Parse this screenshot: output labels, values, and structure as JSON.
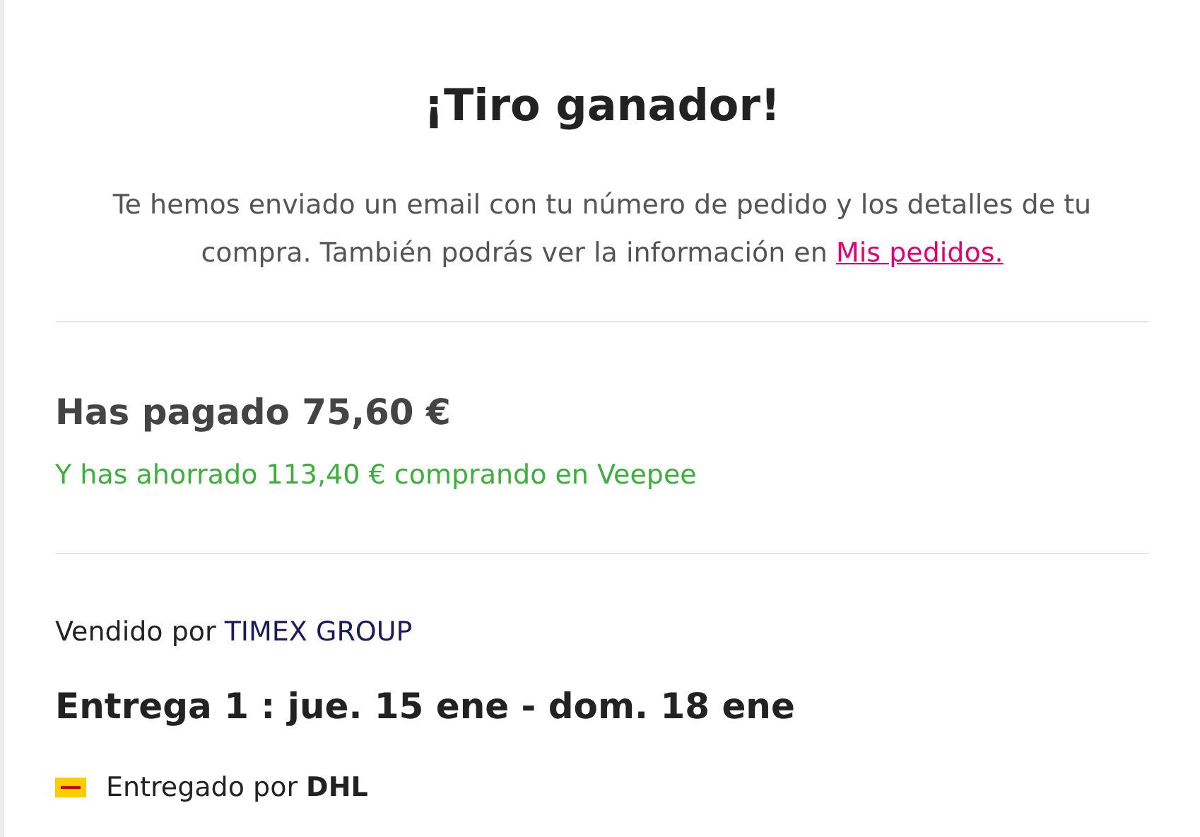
{
  "title": "¡Tiro ganador!",
  "message": {
    "text": "Te hemos enviado un email con tu número de pedido y los detalles de tu compra. También podrás ver la información en",
    "link": "Mis pedidos."
  },
  "payment": {
    "paid": "Has pagado 75,60 €",
    "savings": "Y has ahorrado 113,40 € comprando en Veepee"
  },
  "seller": {
    "label": "Vendido por",
    "name": "TIMEX GROUP"
  },
  "delivery": {
    "title": "Entrega 1 : jue. 15 ene - dom. 18 ene",
    "carrier": "Entregado por **DHL**"
  }
}
